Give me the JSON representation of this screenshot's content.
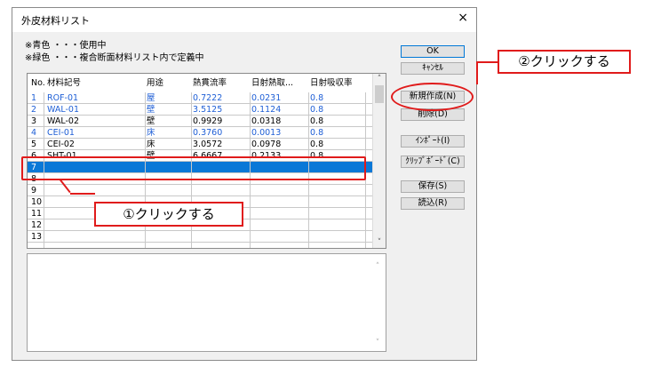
{
  "window": {
    "title": "外皮材料リスト",
    "close_glyph": "×"
  },
  "legend": [
    "※青色 ・・・使用中",
    "※緑色 ・・・複合断面材料リスト内で定義中"
  ],
  "table": {
    "headers": [
      "No.",
      "材料記号",
      "用途",
      "熱貫流率",
      "日射熱取...",
      "日射吸収率"
    ],
    "rows": [
      {
        "no": "1",
        "code": "ROF-01",
        "use": "屋",
        "u": "0.7222",
        "solar": "0.0231",
        "abs": "0.8",
        "color": "#1f5fd6"
      },
      {
        "no": "2",
        "code": "WAL-01",
        "use": "壁",
        "u": "3.5125",
        "solar": "0.1124",
        "abs": "0.8",
        "color": "#1f5fd6"
      },
      {
        "no": "3",
        "code": "WAL-02",
        "use": "壁",
        "u": "0.9929",
        "solar": "0.0318",
        "abs": "0.8",
        "color": "#000000"
      },
      {
        "no": "4",
        "code": "CEI-01",
        "use": "床",
        "u": "0.3760",
        "solar": "0.0013",
        "abs": "0.8",
        "color": "#1f5fd6"
      },
      {
        "no": "5",
        "code": "CEI-02",
        "use": "床",
        "u": "3.0572",
        "solar": "0.0978",
        "abs": "0.8",
        "color": "#000000"
      },
      {
        "no": "6",
        "code": "SHT-01",
        "use": "壁",
        "u": "6.6667",
        "solar": "0.2133",
        "abs": "0.8",
        "color": "#000000"
      },
      {
        "no": "7",
        "code": "",
        "use": "",
        "u": "",
        "solar": "",
        "abs": "",
        "color": "#ffffff",
        "selected": true
      },
      {
        "no": "8",
        "code": "",
        "use": "",
        "u": "",
        "solar": "",
        "abs": "",
        "color": "#000000"
      },
      {
        "no": "9",
        "code": "",
        "use": "",
        "u": "",
        "solar": "",
        "abs": "",
        "color": "#000000"
      },
      {
        "no": "10",
        "code": "",
        "use": "",
        "u": "",
        "solar": "",
        "abs": "",
        "color": "#000000"
      },
      {
        "no": "11",
        "code": "",
        "use": "",
        "u": "",
        "solar": "",
        "abs": "",
        "color": "#000000"
      },
      {
        "no": "12",
        "code": "",
        "use": "",
        "u": "",
        "solar": "",
        "abs": "",
        "color": "#000000"
      },
      {
        "no": "13",
        "code": "",
        "use": "",
        "u": "",
        "solar": "",
        "abs": "",
        "color": "#000000"
      }
    ],
    "selected_color": "#0a78d7"
  },
  "buttons": {
    "ok": "OK",
    "cancel": "ｷｬﾝｾﾙ",
    "new": "新規作成(N)",
    "delete": "削除(D)",
    "import": "ｲﾝﾎﾟｰﾄ(I)",
    "clipboard": "ｸﾘｯﾌﾟﾎﾞｰﾄﾞ(C)",
    "save": "保存(S)",
    "load": "読込(R)"
  },
  "annotations": {
    "step1": "①クリックする",
    "step2": "②クリックする",
    "accent": "#e01b1b"
  }
}
